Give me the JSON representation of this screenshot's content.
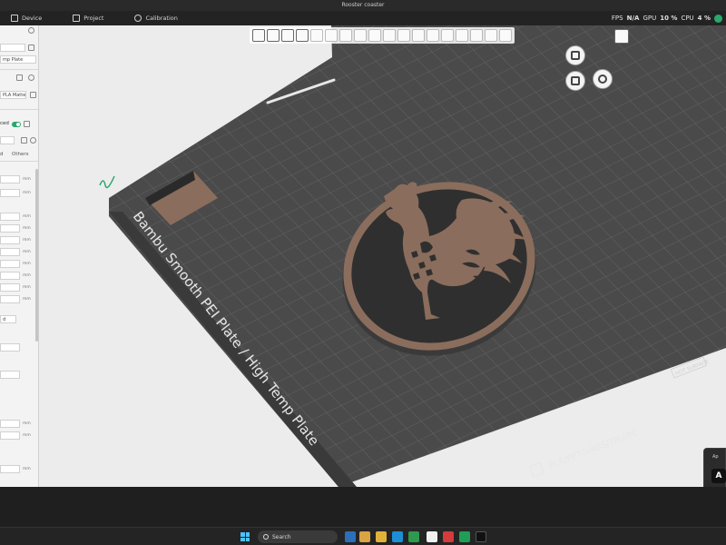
{
  "window": {
    "title": "Rooster coaster"
  },
  "topbar": {
    "tabs": [
      {
        "label": "Device",
        "icon": "device-icon"
      },
      {
        "label": "Project",
        "icon": "project-icon"
      },
      {
        "label": "Calibration",
        "icon": "calibration-icon"
      }
    ],
    "stats": {
      "fps_label": "FPS",
      "fps_value": "N/A",
      "gpu_label": "GPU",
      "gpu_value": "10 %",
      "cpu_label": "CPU",
      "cpu_value": "4 %"
    }
  },
  "sidebar": {
    "plate_type": "mp Plate",
    "filament": "PLA Matte",
    "advanced_label": "ced",
    "tab_partial": "d",
    "tab_others": "Others",
    "units": [
      "mm",
      "mm",
      "mm",
      "mm",
      "mm",
      "mm",
      "mm",
      "mm",
      "mm",
      "mm",
      "mm",
      "mm",
      "mm"
    ],
    "misc_value": "d"
  },
  "plate": {
    "name_label": "Bambu Smooth PEI Plate / High Temp Plate",
    "material_label": "PLA/PETG/ABS/TPU/PC",
    "surface_label": "HOT SURFACE",
    "model": "rooster-coaster"
  },
  "colors": {
    "bed": "#4a4a4a",
    "grid": "#6a6a6a",
    "coaster_edge": "#8a6d5c",
    "coaster_body": "#2f2f2f",
    "accent": "#29a86e"
  },
  "notification": {
    "title": "Ap",
    "app_icon": "app-logo-icon"
  },
  "taskbar": {
    "search_placeholder": "Search"
  }
}
